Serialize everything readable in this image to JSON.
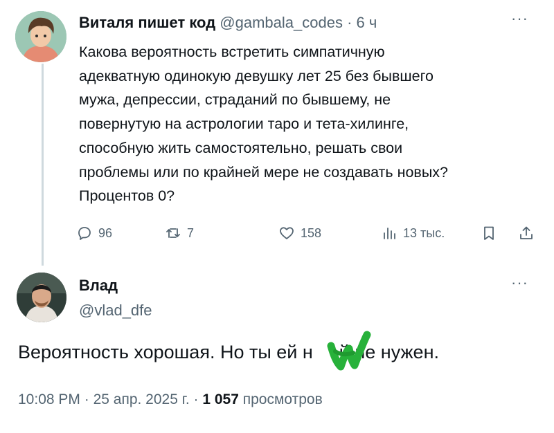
{
  "tweet": {
    "author_name": "Виталя пишет код",
    "author_handle": "@gambala_codes",
    "separator": "·",
    "time": "6 ч",
    "more": "···",
    "lines": [
      "Какова вероятность встретить симпатичную",
      "адекватную одинокую девушку лет 25 без бывшего",
      "мужа, депрессии, страданий по бывшему, не",
      "повернутую на астрологии таро и тета-хилинге,",
      "способную жить самостоятельно, решать свои",
      "проблемы или по крайней мере не создавать новых?",
      "Процентов 0?"
    ],
    "actions": {
      "replies": "96",
      "retweets": "7",
      "likes": "158",
      "views": "13 тыс."
    }
  },
  "reply": {
    "author_name": "Влад",
    "author_handle": "@vlad_dfe",
    "more": "···",
    "text_before": "Вероятность хорошая. Но ты ей н",
    "text_after": "й не нужен.",
    "meta": {
      "time": "10:08 PM",
      "separator": "·",
      "date": "25 апр. 2025 г.",
      "views_count": "1 057",
      "views_label": "просмотров"
    }
  },
  "colors": {
    "muted": "#536471",
    "text": "#0f1419",
    "stamp": "#27b13a"
  },
  "icons": [
    "reply-icon",
    "retweet-icon",
    "like-icon",
    "views-icon",
    "bookmark-icon",
    "share-icon"
  ]
}
